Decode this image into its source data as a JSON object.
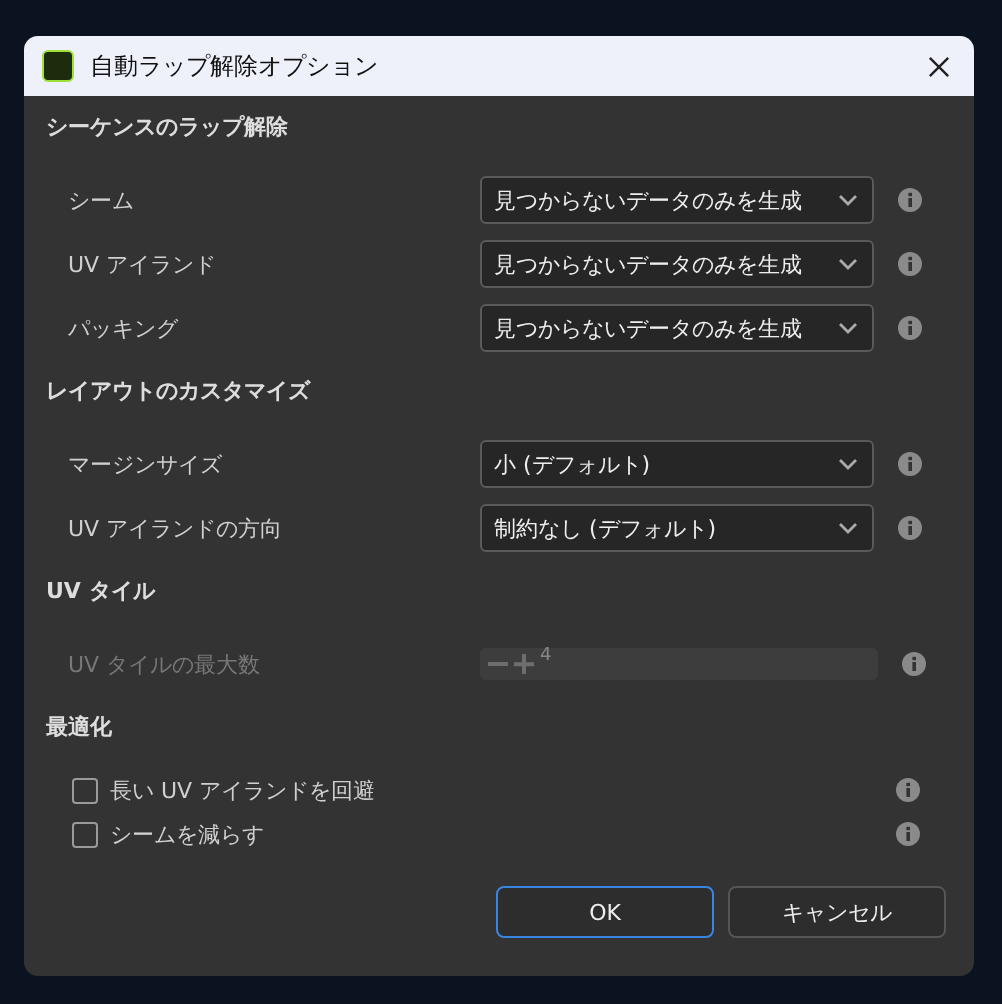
{
  "window": {
    "title": "自動ラップ解除オプション"
  },
  "sections": [
    {
      "title": "シーケンスのラップ解除",
      "rows": [
        {
          "kind": "dropdown",
          "label": "シーム",
          "value": "見つからないデータのみを生成"
        },
        {
          "kind": "dropdown",
          "label": "UV アイランド",
          "value": "見つからないデータのみを生成"
        },
        {
          "kind": "dropdown",
          "label": "パッキング",
          "value": "見つからないデータのみを生成"
        }
      ]
    },
    {
      "title": "レイアウトのカスタマイズ",
      "rows": [
        {
          "kind": "dropdown",
          "label": "マージンサイズ",
          "value": "小 (デフォルト)"
        },
        {
          "kind": "dropdown",
          "label": "UV アイランドの方向",
          "value": "制約なし (デフォルト)"
        }
      ]
    },
    {
      "title": "UV タイル",
      "rows": [
        {
          "kind": "number",
          "label": "UV タイルの最大数",
          "value": "4",
          "disabled": true
        }
      ]
    },
    {
      "title": "最適化",
      "rows": [
        {
          "kind": "checkbox",
          "label": "長い UV アイランドを回避",
          "checked": false
        },
        {
          "kind": "checkbox",
          "label": "シームを減らす",
          "checked": false
        }
      ]
    }
  ],
  "buttons": [
    {
      "label": "OK",
      "primary": true
    },
    {
      "label": "キャンセル",
      "primary": false
    }
  ]
}
